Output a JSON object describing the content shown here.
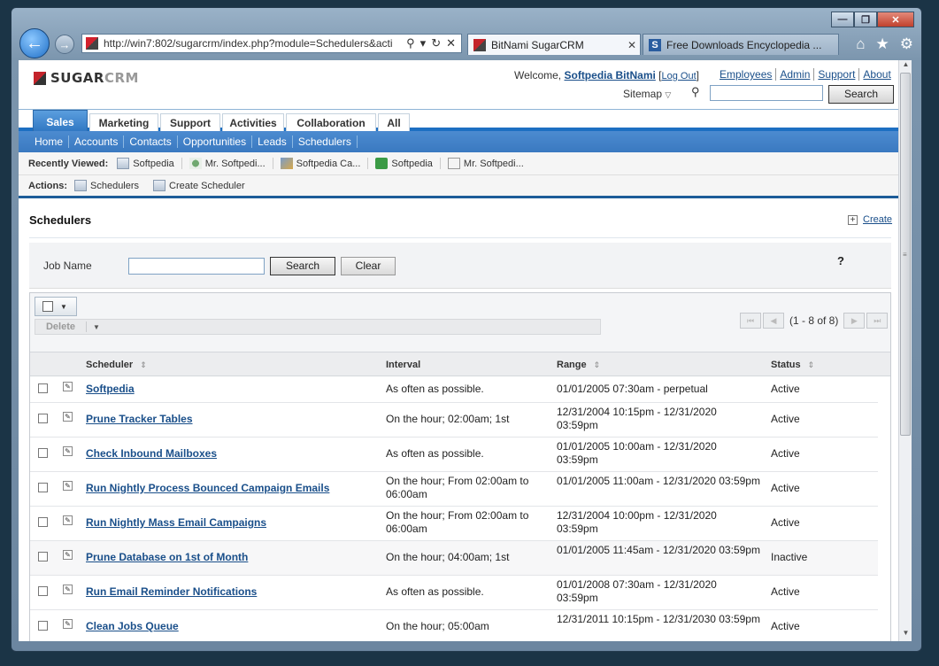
{
  "browser": {
    "url": "http://win7:802/sugarcrm/index.php?module=Schedulers&acti",
    "tabs": [
      {
        "label": "BitNami SugarCRM",
        "active": true
      },
      {
        "label": "Free Downloads Encyclopedia ...",
        "active": false
      }
    ],
    "window_controls": [
      "—",
      "❐",
      "✕"
    ]
  },
  "header": {
    "logo_sugar": "SUGAR",
    "logo_crm": "CRM",
    "welcome_prefix": "Welcome,",
    "user_name": "Softpedia BitNami",
    "logout_open": "[",
    "logout": "Log Out",
    "logout_close": "]",
    "top_links": [
      "Employees",
      "Admin",
      "Support",
      "About"
    ],
    "sitemap": "Sitemap",
    "search_button": "Search",
    "search_value": ""
  },
  "module_tabs": [
    "Sales",
    "Marketing",
    "Support",
    "Activities",
    "Collaboration",
    "All"
  ],
  "active_tab": "Sales",
  "sub_nav": [
    "Home",
    "Accounts",
    "Contacts",
    "Opportunities",
    "Leads",
    "Schedulers"
  ],
  "recently_viewed": {
    "label": "Recently Viewed:",
    "items": [
      "Softpedia",
      "Mr. Softpedi...",
      "Softpedia Ca...",
      "Softpedia",
      "Mr. Softpedi..."
    ]
  },
  "actions": {
    "label": "Actions:",
    "items": [
      "Schedulers",
      "Create Scheduler"
    ]
  },
  "page": {
    "title": "Schedulers",
    "create_link": "Create",
    "search": {
      "label": "Job Name",
      "value": "",
      "search_button": "Search",
      "clear_button": "Clear",
      "help": "?"
    },
    "toolbar": {
      "delete": "Delete",
      "pagination": "(1 - 8 of 8)"
    },
    "columns": [
      "Scheduler",
      "Interval",
      "Range",
      "Status"
    ],
    "rows": [
      {
        "name": "Softpedia",
        "interval": "As often as possible.",
        "range": "01/01/2005 07:30am - perpetual",
        "status": "Active"
      },
      {
        "name": "Prune Tracker Tables",
        "interval": "On the hour; 02:00am; 1st",
        "range": "12/31/2004 10:15pm - 12/31/2020 03:59pm",
        "status": "Active"
      },
      {
        "name": "Check Inbound Mailboxes",
        "interval": "As often as possible.",
        "range": "01/01/2005 10:00am - 12/31/2020 03:59pm",
        "status": "Active"
      },
      {
        "name": "Run Nightly Process Bounced Campaign Emails",
        "interval": "On the hour; From 02:00am to 06:00am",
        "range": "01/01/2005 11:00am - 12/31/2020 03:59pm",
        "status": "Active"
      },
      {
        "name": "Run Nightly Mass Email Campaigns",
        "interval": "On the hour; From 02:00am to 06:00am",
        "range": "12/31/2004 10:00pm - 12/31/2020 03:59pm",
        "status": "Active"
      },
      {
        "name": "Prune Database on 1st of Month",
        "interval": "On the hour; 04:00am; 1st",
        "range": "01/01/2005 11:45am - 12/31/2020 03:59pm",
        "status": "Inactive"
      },
      {
        "name": "Run Email Reminder Notifications",
        "interval": "As often as possible.",
        "range": "01/01/2008 07:30am - 12/31/2020 03:59pm",
        "status": "Active"
      },
      {
        "name": "Clean Jobs Queue",
        "interval": "On the hour; 05:00am",
        "range": "12/31/2011 10:15pm - 12/31/2030 03:59pm",
        "status": "Active"
      }
    ]
  },
  "colors": {
    "accent_blue": "#2d75c1",
    "link_blue": "#1a4f8a",
    "logo_red": "#c4242b"
  }
}
